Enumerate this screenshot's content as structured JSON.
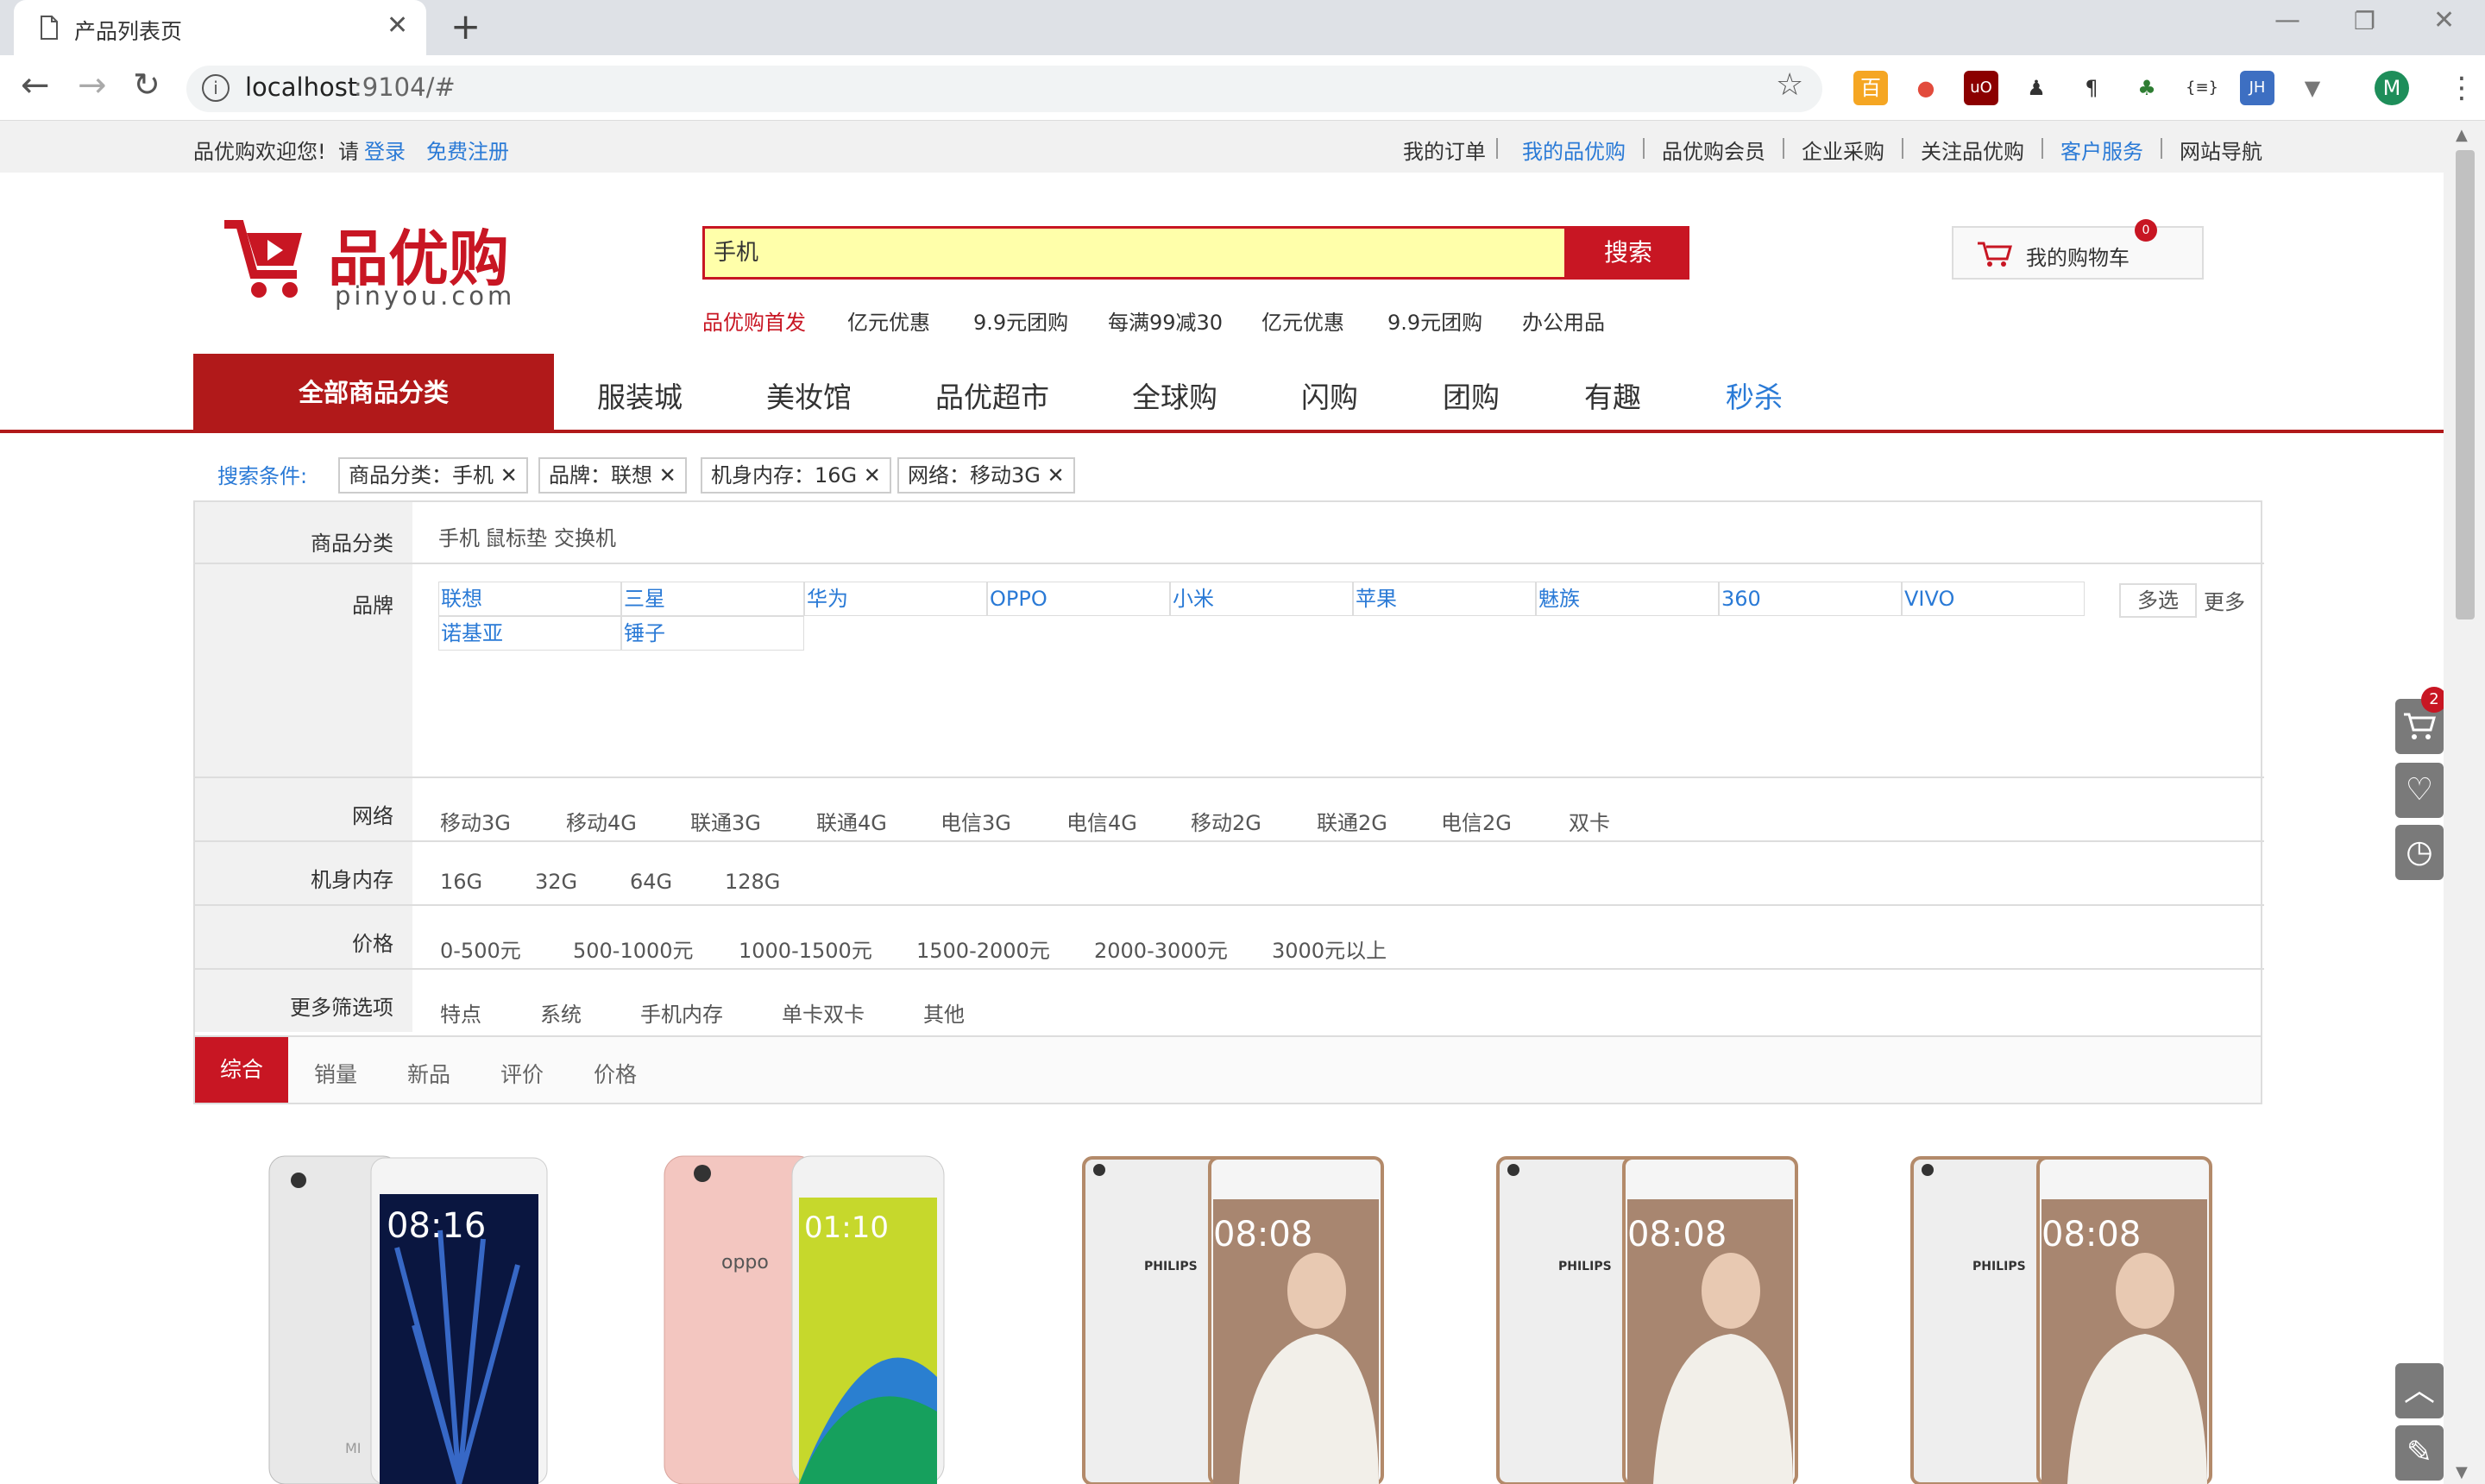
{
  "browser": {
    "tab_title": "产品列表页",
    "url_host": "localhost",
    "url_rest": ":9104/#",
    "profile_letter": "M"
  },
  "topbar": {
    "welcome": "品优购欢迎您!",
    "please": "请",
    "login": "登录",
    "register": "免费注册",
    "links": [
      "我的订单",
      "我的品优购",
      "品优购会员",
      "企业采购",
      "关注品优购",
      "客户服务",
      "网站导航"
    ]
  },
  "logo": {
    "cn": "品优购",
    "en": "pinyou.com"
  },
  "search": {
    "value": "手机",
    "button": "搜索"
  },
  "hot_words": [
    "品优购首发",
    "亿元优惠",
    "9.9元团购",
    "每满99减30",
    "亿元优惠",
    "9.9元团购",
    "办公用品"
  ],
  "cart": {
    "label": "我的购物车",
    "count": "0"
  },
  "nav": {
    "all": "全部商品分类",
    "items": [
      "服装城",
      "美妆馆",
      "品优超市",
      "全球购",
      "闪购",
      "团购",
      "有趣",
      "秒杀"
    ]
  },
  "conditions": {
    "label": "搜索条件:",
    "tags": [
      "商品分类：手机",
      "品牌：联想",
      "机身内存：16G",
      "网络：移动3G"
    ]
  },
  "filters": {
    "category": {
      "label": "商品分类",
      "options": [
        "手机",
        "鼠标垫",
        "交换机"
      ]
    },
    "brand": {
      "label": "品牌",
      "options": [
        "联想",
        "三星",
        "华为",
        "OPPO",
        "小米",
        "苹果",
        "魅族",
        "360",
        "VIVO",
        "诺基亚",
        "锤子"
      ],
      "multi": "多选",
      "more": "更多"
    },
    "network": {
      "label": "网络",
      "options": [
        "移动3G",
        "移动4G",
        "联通3G",
        "联通4G",
        "电信3G",
        "电信4G",
        "移动2G",
        "联通2G",
        "电信2G",
        "双卡"
      ]
    },
    "memory": {
      "label": "机身内存",
      "options": [
        "16G",
        "32G",
        "64G",
        "128G"
      ]
    },
    "price": {
      "label": "价格",
      "options": [
        "0-500元",
        "500-1000元",
        "1000-1500元",
        "1500-2000元",
        "2000-3000元",
        "3000元以上"
      ]
    },
    "more": {
      "label": "更多筛选项",
      "options": [
        "特点",
        "系统",
        "手机内存",
        "单卡双卡",
        "其他"
      ]
    }
  },
  "sort": [
    "综合",
    "销量",
    "新品",
    "评价",
    "价格"
  ],
  "sidebar": {
    "cart_badge": "2"
  },
  "products": [
    {
      "brand": "MI",
      "time": "08:16"
    },
    {
      "brand": "oppo",
      "time": "01:10"
    },
    {
      "brand": "PHILIPS",
      "time": "08:08"
    },
    {
      "brand": "PHILIPS",
      "time": "08:08"
    },
    {
      "brand": "PHILIPS",
      "time": "08:08"
    }
  ]
}
